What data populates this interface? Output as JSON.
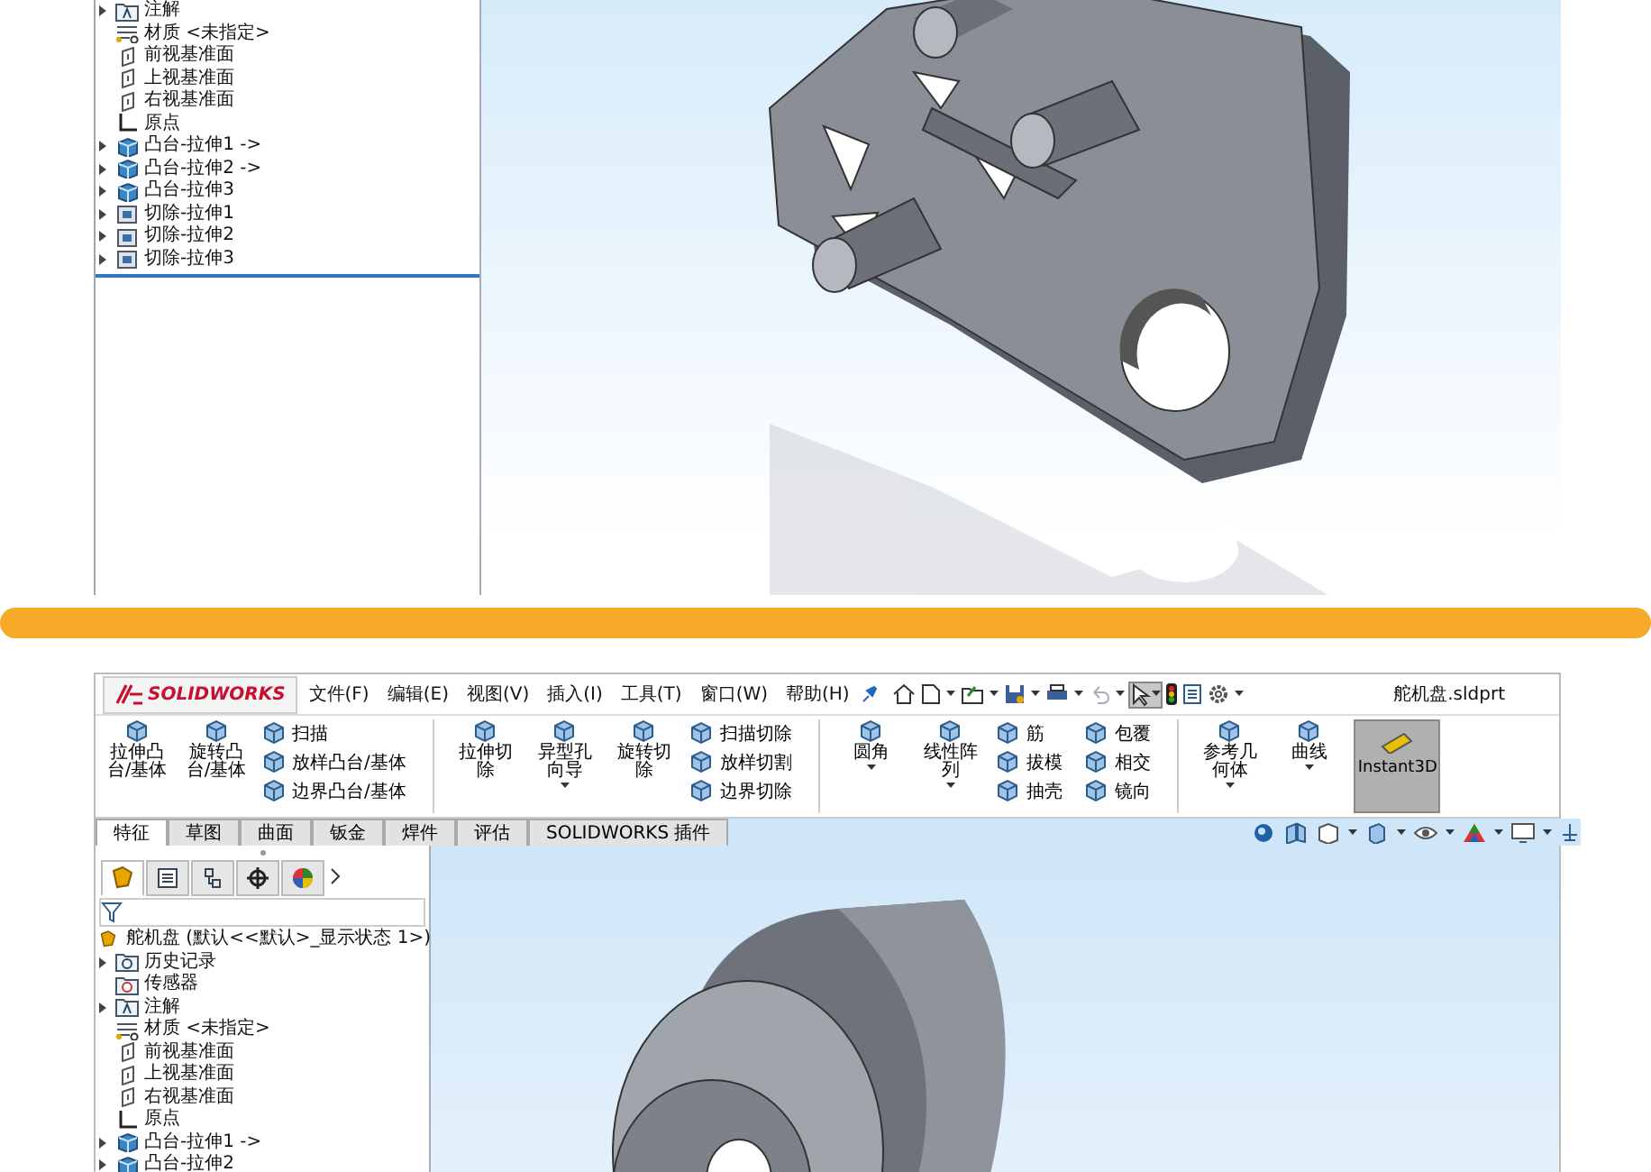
{
  "top_panel": {
    "tree": [
      {
        "label": "注解",
        "kind": "annotation",
        "expandable": true
      },
      {
        "label": "材质 <未指定>",
        "kind": "material",
        "expandable": false
      },
      {
        "label": "前视基准面",
        "kind": "plane",
        "expandable": false
      },
      {
        "label": "上视基准面",
        "kind": "plane",
        "expandable": false
      },
      {
        "label": "右视基准面",
        "kind": "plane",
        "expandable": false
      },
      {
        "label": "原点",
        "kind": "origin",
        "expandable": false
      },
      {
        "label": "凸台-拉伸1 ->",
        "kind": "boss",
        "expandable": true
      },
      {
        "label": "凸台-拉伸2 ->",
        "kind": "boss",
        "expandable": true
      },
      {
        "label": "凸台-拉伸3",
        "kind": "boss",
        "expandable": true
      },
      {
        "label": "切除-拉伸1",
        "kind": "cut",
        "expandable": true
      },
      {
        "label": "切除-拉伸2",
        "kind": "cut",
        "expandable": true
      },
      {
        "label": "切除-拉伸3",
        "kind": "cut",
        "expandable": true
      }
    ]
  },
  "bottom_panel": {
    "logo": "SOLIDWORKS",
    "menu": [
      "文件(F)",
      "编辑(E)",
      "视图(V)",
      "插入(I)",
      "工具(T)",
      "窗口(W)",
      "帮助(H)"
    ],
    "select_tool_pressed": true,
    "file_name": "舵机盘.sldprt",
    "commands": [
      {
        "kind": "large",
        "label": "拉伸凸台/基体",
        "dropdown": false
      },
      {
        "kind": "large",
        "label": "旋转凸台/基体",
        "dropdown": false
      },
      {
        "kind": "stack",
        "items": [
          "扫描",
          "放样凸台/基体",
          "边界凸台/基体"
        ]
      },
      {
        "kind": "separator"
      },
      {
        "kind": "large",
        "label": "拉伸切除",
        "dropdown": false
      },
      {
        "kind": "large",
        "label": "异型孔向导",
        "dropdown": true
      },
      {
        "kind": "large",
        "label": "旋转切除",
        "dropdown": false
      },
      {
        "kind": "stack",
        "items": [
          "扫描切除",
          "放样切割",
          "边界切除"
        ]
      },
      {
        "kind": "separator"
      },
      {
        "kind": "large",
        "label": "圆角",
        "dropdown": true
      },
      {
        "kind": "large",
        "label": "线性阵列",
        "dropdown": true
      },
      {
        "kind": "stack",
        "items": [
          "筋",
          "拔模",
          "抽壳"
        ]
      },
      {
        "kind": "stack",
        "items": [
          "包覆",
          "相交",
          "镜向"
        ]
      },
      {
        "kind": "separator"
      },
      {
        "kind": "large",
        "label": "参考几何体",
        "dropdown": true
      },
      {
        "kind": "large",
        "label": "曲线",
        "dropdown": true
      },
      {
        "kind": "toggle",
        "label": "Instant3D",
        "pressed": true
      }
    ],
    "tabs": [
      {
        "label": "特征",
        "selected": true
      },
      {
        "label": "草图",
        "selected": false
      },
      {
        "label": "曲面",
        "selected": false
      },
      {
        "label": "钣金",
        "selected": false
      },
      {
        "label": "焊件",
        "selected": false
      },
      {
        "label": "评估",
        "selected": false
      },
      {
        "label": "SOLIDWORKS 插件",
        "selected": false
      }
    ],
    "tree_tabs": [
      {
        "kind": "feature",
        "selected": true
      },
      {
        "kind": "property",
        "selected": false
      },
      {
        "kind": "config",
        "selected": false
      },
      {
        "kind": "dimxpert",
        "selected": false
      },
      {
        "kind": "display",
        "selected": false
      }
    ],
    "tree_root": "舵机盘 (默认<<默认>_显示状态 1>)",
    "tree": [
      {
        "label": "历史记录",
        "kind": "history",
        "expandable": true
      },
      {
        "label": "传感器",
        "kind": "sensor",
        "expandable": false
      },
      {
        "label": "注解",
        "kind": "annotation",
        "expandable": true
      },
      {
        "label": "材质 <未指定>",
        "kind": "material",
        "expandable": false
      },
      {
        "label": "前视基准面",
        "kind": "plane",
        "expandable": false
      },
      {
        "label": "上视基准面",
        "kind": "plane",
        "expandable": false
      },
      {
        "label": "右视基准面",
        "kind": "plane",
        "expandable": false
      },
      {
        "label": "原点",
        "kind": "origin",
        "expandable": false
      },
      {
        "label": "凸台-拉伸1 ->",
        "kind": "boss",
        "expandable": true
      },
      {
        "label": "凸台-拉伸2",
        "kind": "boss",
        "expandable": true
      }
    ]
  }
}
